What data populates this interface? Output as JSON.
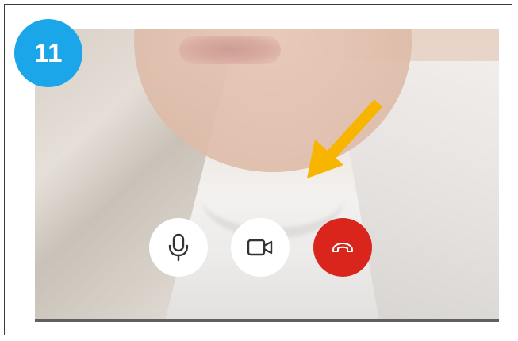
{
  "step_badge": {
    "number": "11",
    "color": "#1aa6e8"
  },
  "annotation": {
    "arrow_color": "#f7b500",
    "points_to": "end-call-button"
  },
  "call_controls": {
    "buttons": [
      {
        "id": "microphone",
        "icon": "microphone-icon",
        "background": "#ffffff",
        "icon_color": "#333333"
      },
      {
        "id": "camera",
        "icon": "video-camera-icon",
        "background": "#ffffff",
        "icon_color": "#333333"
      },
      {
        "id": "end_call",
        "icon": "hang-up-phone-icon",
        "background": "#d9251b",
        "icon_color": "#ffffff"
      }
    ]
  }
}
